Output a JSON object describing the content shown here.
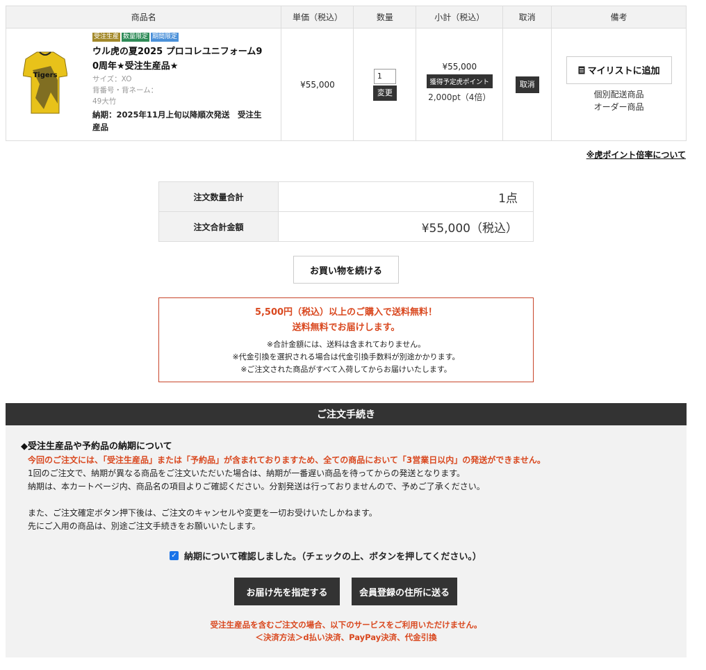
{
  "table_headers": [
    "商品名",
    "単価（税込）",
    "数量",
    "小計（税込）",
    "取消",
    "備考"
  ],
  "item": {
    "badges": [
      {
        "label": "受注生産",
        "color": "#a3892a"
      },
      {
        "label": "数量限定",
        "color": "#2e8b57"
      },
      {
        "label": "期間限定",
        "color": "#4a90d9"
      }
    ],
    "name_line1": "ウル虎の夏2025 プロコレユニフォーム9",
    "name_line2": "0周年★受注生産品★",
    "size": "サイズ：XO",
    "back_label": "背番号・背ネーム：",
    "back_value": "49大竹",
    "delivery_line1": "納期：2025年11月上旬以降順次発送　受注生",
    "delivery_line2": "産品",
    "unit_price": "¥55,000",
    "quantity": "1",
    "change_label": "変更",
    "subtotal": "¥55,000",
    "point_badge": "獲得予定虎ポイント",
    "points": "2,000pt（4倍）",
    "cancel_label": "取消",
    "mylist_label": "マイリストに追加",
    "note1": "個別配送商品",
    "note2": "オーダー商品",
    "jersey_logo": "Tigers"
  },
  "point_link": "※虎ポイント倍率について",
  "summary": {
    "qty_label": "注文数量合計",
    "qty_value": "1点",
    "total_label": "注文合計金額",
    "total_value": "¥55,000（税込）"
  },
  "continue_label": "お買い物を続ける",
  "shipping": {
    "red1": "5,500円（税込）以上のご購入で送料無料！",
    "red2": "送料無料でお届けします。",
    "n1": "※合計金額には、送料は含まれておりません。",
    "n2": "※代金引換を選択される場合は代金引換手数料が別途かかります。",
    "n3": "※ご注文された商品がすべて入荷してからお届けいたします。"
  },
  "procedure": {
    "header": "ご注文手続き",
    "title": "◆受注生産品や予約品の納期について",
    "red": "今回のご注文には、「受注生産品」または「予約品」が含まれておりますため、全ての商品において「3営業日以内」の発送ができません。",
    "l1": "1回のご注文で、納期が異なる商品をご注文いただいた場合は、納期が一番遅い商品を待ってからの発送となります。",
    "l2": "納期は、本カートページ内、商品名の項目よりご確認ください。分割発送は行っておりませんので、予めご了承ください。",
    "l3": "また、ご注文確定ボタン押下後は、ご注文のキャンセルや変更を一切お受けいたしかねます。",
    "l4": "先にご入用の商品は、別途ご注文手続きをお願いいたします。",
    "confirm": "納期について確認しました。（チェックの上、ボタンを押してください。）",
    "btn1": "お届け先を指定する",
    "btn2": "会員登録の住所に送る",
    "foot1": "受注生産品を含むご注文の場合、以下のサービスをご利用いただけません。",
    "foot2": "＜決済方法＞d払い決済、PayPay決済、代金引換"
  }
}
